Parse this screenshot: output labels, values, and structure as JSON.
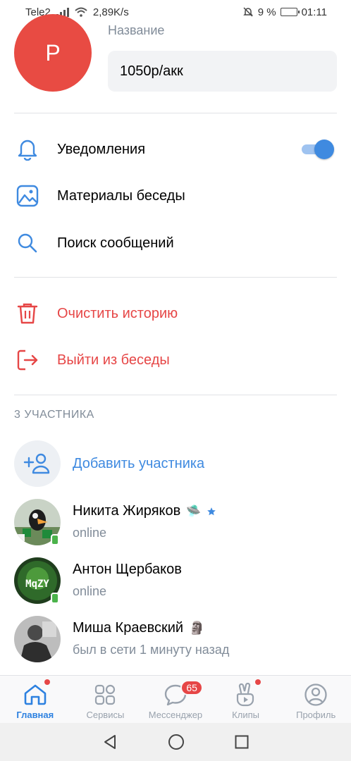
{
  "statusbar": {
    "carrier": "Tele2",
    "speed": "2,89K/s",
    "battery": "9 %",
    "time": "01:11"
  },
  "chat": {
    "avatar_letter": "Р",
    "avatar_color": "#e84b43",
    "name_label": "Название",
    "name_value": "1050р/акк"
  },
  "menu": {
    "notifications": "Уведомления",
    "notifications_enabled": true,
    "materials": "Материалы беседы",
    "search": "Поиск сообщений",
    "clear_history": "Очистить историю",
    "leave": "Выйти из беседы"
  },
  "members": {
    "title": "3 УЧАСТНИКА",
    "add_label": "Добавить участника",
    "list": [
      {
        "name": "Никита Жиряков",
        "emoji": "🛸",
        "status": "online"
      },
      {
        "name": "Антон Щербаков",
        "status": "online"
      },
      {
        "name": "Миша Краевский",
        "emoji": "🗿",
        "status": "был в сети 1 минуту назад"
      }
    ]
  },
  "tabs": {
    "home": "Главная",
    "services": "Сервисы",
    "messenger": "Мессенджер",
    "messenger_badge": "65",
    "clips": "Клипы",
    "profile": "Профиль"
  },
  "colors": {
    "accent": "#3f8ae0",
    "danger": "#e64646",
    "online": "#4bb34b"
  }
}
